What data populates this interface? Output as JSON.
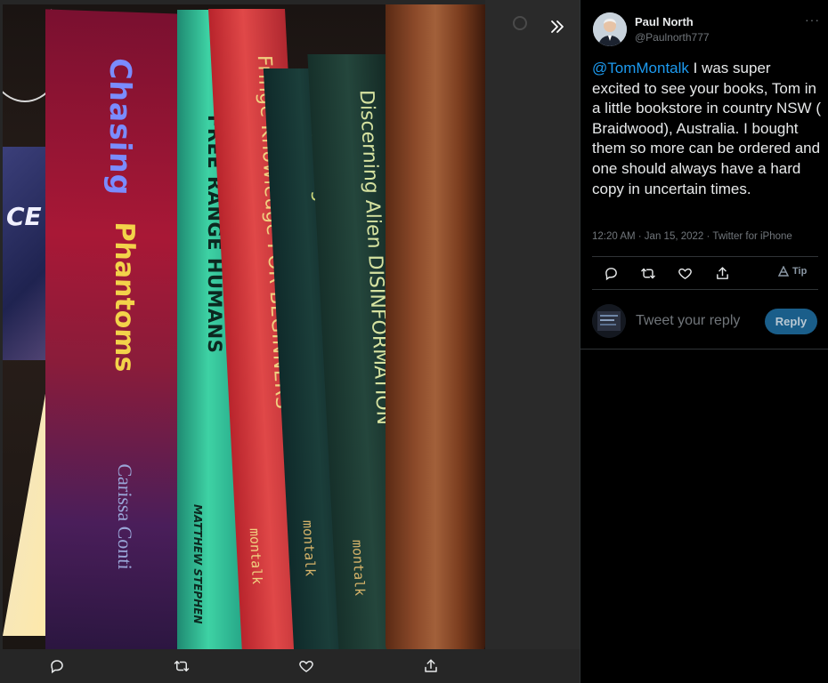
{
  "viewer": {
    "book_titles": {
      "b1_title_1": "Chasing",
      "b1_title_2": "Phantoms",
      "b1_author": "Carissa Conti",
      "b2_title": "FREE RANGE HUMANS",
      "b2_author": "MATTHEW STEPHEN",
      "b3_title": "Fringe Knowledge FOR BEGINNERS",
      "b3_publisher": "montalk",
      "b4_title": "Discerning Alien DISINFORMATION",
      "b4_publisher": "montalk",
      "b5_title": "Discerning Alien DISINFORMATION",
      "b5_publisher": "montalk",
      "lightbox_text": "CE"
    },
    "expand_icon": "chevron-double-right-icon",
    "media_actions": [
      "reply-icon",
      "retweet-icon",
      "like-icon",
      "share-icon"
    ]
  },
  "tweet": {
    "author_name": "Paul North",
    "author_handle": "@Paulnorth777",
    "more_label": "···",
    "mention": "@TomMontalk",
    "body": " I was super excited to see your books, Tom in a little bookstore in country NSW ( Braidwood), Australia. I bought them so more can be ordered and one should always have a hard copy in uncertain times.",
    "meta": "12:20 AM · Jan 15, 2022 · Twitter for iPhone",
    "actions": [
      "reply-icon",
      "retweet-icon",
      "like-icon",
      "share-icon"
    ],
    "tip_label": "Tip"
  },
  "reply": {
    "placeholder": "Tweet your reply",
    "button_label": "Reply"
  },
  "colors": {
    "accent": "#1d9bf0",
    "background": "#000000",
    "muted": "#71767b",
    "reply_button": "#1a5e8a"
  }
}
